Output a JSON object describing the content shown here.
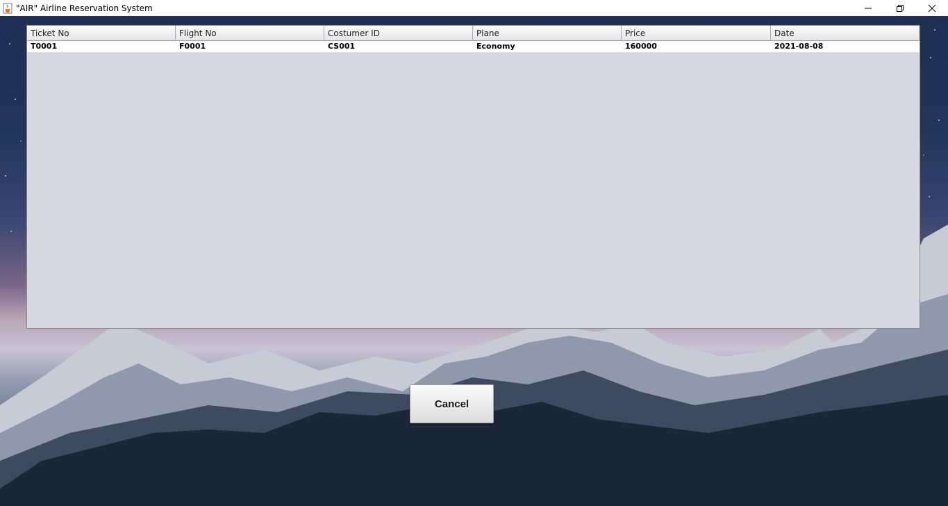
{
  "window": {
    "title": "\"AIR\" Airline Reservation System",
    "icons": {
      "app": "java-cup-icon",
      "minimize": "minimize-icon",
      "restore": "restore-icon",
      "close": "close-icon"
    }
  },
  "table": {
    "columns": [
      "Ticket No",
      "Flight No",
      "Costumer ID",
      "Plane",
      "Price",
      "Date"
    ],
    "rows": [
      [
        "T0001",
        "F0001",
        "CS001",
        "Economy",
        "160000",
        "2021-08-08"
      ]
    ]
  },
  "buttons": {
    "cancel_label": "Cancel"
  },
  "colors": {
    "table_bg": "#d6d9e1",
    "row_bg": "#ffffff",
    "sky_top": "#1d2f52",
    "sky_glow": "#b7a6b8",
    "forest": "#1b2636"
  }
}
